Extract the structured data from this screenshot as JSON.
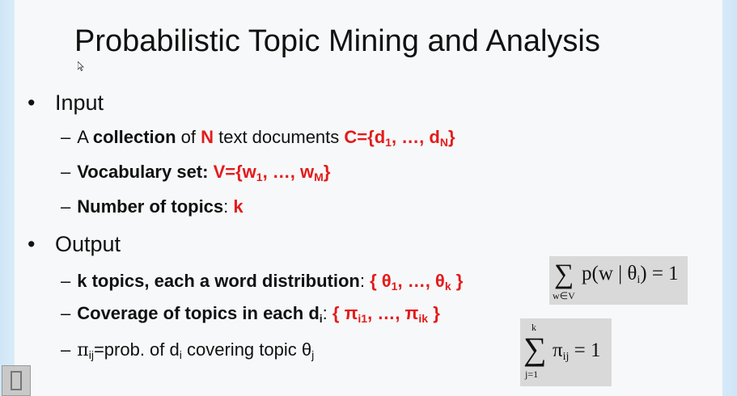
{
  "title": "Probabilistic Topic Mining and Analysis",
  "input": {
    "label": "Input",
    "items": [
      {
        "t1": "A ",
        "t2": "collection",
        "t3": " of ",
        "t4": "N",
        "t5": " text documents ",
        "t6": "C={d",
        "t7": "1",
        "t8": ", …, d",
        "t9": "N",
        "t10": "}"
      },
      {
        "t1": "Vocabulary set:",
        "t2": " V={w",
        "t3": "1",
        "t4": ", …, w",
        "t5": "M",
        "t6": "}"
      },
      {
        "t1": "Number of topics",
        "t2": ": ",
        "t3": "k"
      }
    ]
  },
  "output": {
    "label": "Output",
    "items": [
      {
        "t1": "k topics, each a word distribution",
        "t2": ": ",
        "t3": "{ θ",
        "t4": "1",
        "t5": ", …, θ",
        "t6": "k",
        "t7": " }"
      },
      {
        "t1": "Coverage of topics in each d",
        "t2": "i",
        "t3": ": ",
        "t4": "{ π",
        "t5": "i1",
        "t6": ", …, π",
        "t7": "ik",
        "t8": " }"
      },
      {
        "t1": "π",
        "t2": "ij",
        "t3": "=prob. of d",
        "t4": "i",
        "t5": " covering topic θ",
        "t6": "j"
      }
    ]
  },
  "formula1": {
    "sigma": "∑",
    "sub": "w∈V",
    "expr": "p(w | θ",
    "expr_sub": "i",
    "expr_end": ") = 1"
  },
  "formula2": {
    "sigma": "∑",
    "top": "k",
    "bottom": "j=1",
    "expr": "π",
    "expr_sub": "ij",
    "expr_end": " = 1"
  },
  "colors": {
    "accent": "#e31b1b",
    "formula_bg": "#d9d9d9"
  }
}
